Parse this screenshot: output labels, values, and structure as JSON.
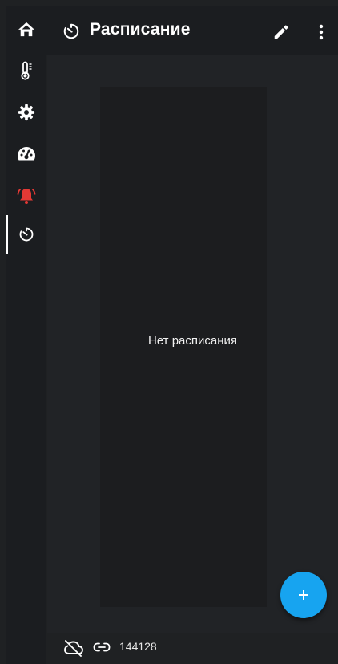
{
  "sidebar": {
    "items": [
      {
        "icon": "home-icon"
      },
      {
        "icon": "thermometer-icon"
      },
      {
        "icon": "gear-icon"
      },
      {
        "icon": "speedometer-icon"
      },
      {
        "icon": "alarm-bell-icon",
        "color": "#e53935"
      },
      {
        "icon": "timer-schedule-icon",
        "active": true
      }
    ]
  },
  "header": {
    "title": "Расписание",
    "title_icon": "timer-schedule-icon",
    "actions": [
      "pencil-icon",
      "more-vert-icon"
    ]
  },
  "main": {
    "empty_message": "Нет расписания"
  },
  "fab": {
    "label": "+",
    "color": "#17a4f0"
  },
  "footer": {
    "cloud_status_icon": "cloud-off-icon",
    "link_icon": "link-icon",
    "device_id": "144128"
  }
}
